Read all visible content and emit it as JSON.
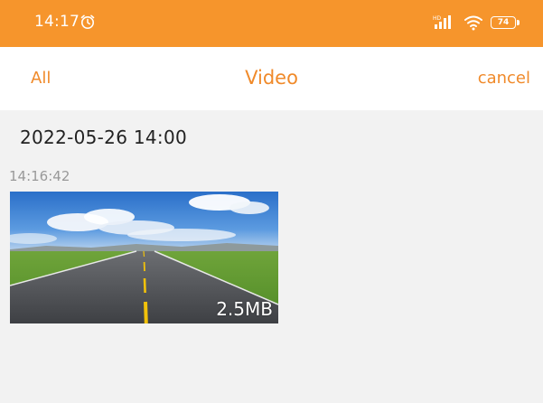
{
  "status_bar": {
    "time": "14:17",
    "battery_level": "74",
    "background": "#f6952c",
    "icons": [
      "alarm-icon",
      "signal-icon",
      "wifi-icon",
      "battery-icon"
    ]
  },
  "nav": {
    "left_label": "All",
    "title": "Video",
    "right_label": "cancel",
    "accent": "#f08a2a"
  },
  "groups": [
    {
      "header": "2022-05-26 14:00",
      "items": [
        {
          "time": "14:16:42",
          "size": "2.5MB"
        }
      ]
    }
  ]
}
